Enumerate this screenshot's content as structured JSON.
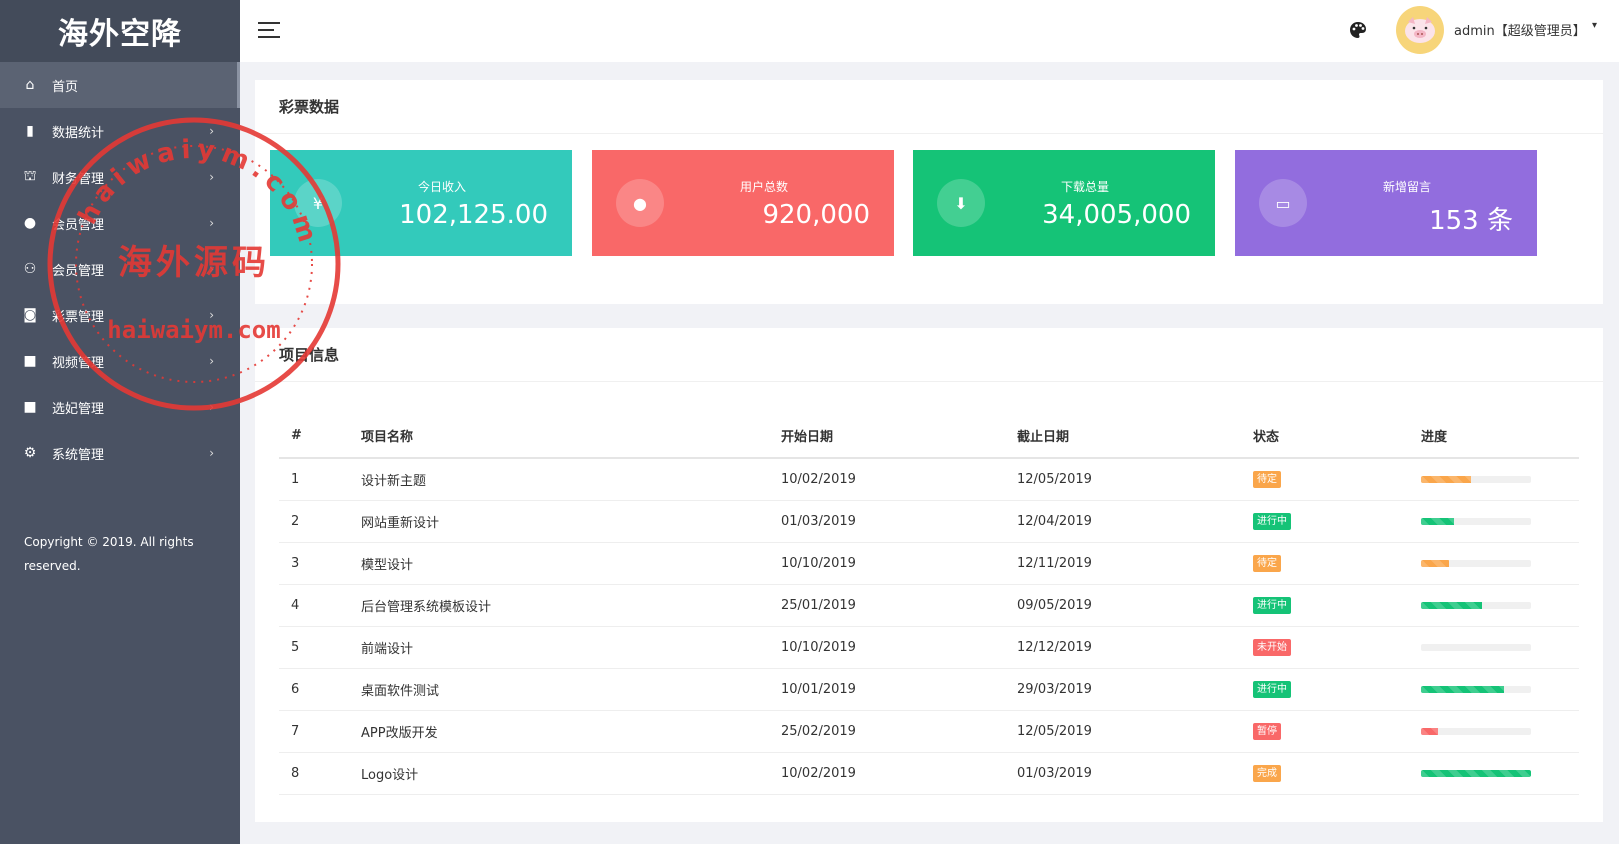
{
  "app": {
    "logo": "海外空降"
  },
  "sidebar": {
    "items": [
      {
        "label": "首页",
        "icon": "home-icon",
        "glyph": "⌂",
        "chevron": ""
      },
      {
        "label": "数据统计",
        "icon": "bar-chart-icon",
        "glyph": "▮",
        "chevron": "›"
      },
      {
        "label": "财务管理",
        "icon": "bank-icon",
        "glyph": "⛫",
        "chevron": "›"
      },
      {
        "label": "会员管理",
        "icon": "user-icon",
        "glyph": "●",
        "chevron": "›"
      },
      {
        "label": "会员管理",
        "icon": "users-icon",
        "glyph": "⚇",
        "chevron": "›"
      },
      {
        "label": "彩票管理",
        "icon": "gamepad-icon",
        "glyph": "◙",
        "chevron": "›"
      },
      {
        "label": "视频管理",
        "icon": "video-camera-icon",
        "glyph": "■",
        "chevron": "›"
      },
      {
        "label": "选妃管理",
        "icon": "video-camera-icon",
        "glyph": "■",
        "chevron": "›"
      },
      {
        "label": "系统管理",
        "icon": "gear-icon",
        "glyph": "⚙",
        "chevron": "›"
      }
    ],
    "copyright": "Copyright © 2019. All rights reserved."
  },
  "header": {
    "user": "admin【超级管理员】",
    "caret": "▾",
    "palette_icon": "palette-icon",
    "menu_icon": "hamburger-menu-icon",
    "avatar_icon": "pig-avatar-icon"
  },
  "stats_card": {
    "title": "彩票数据",
    "stats": [
      {
        "label": "今日收入",
        "value": "102,125.00",
        "icon": "yen-icon",
        "glyph": "¥",
        "color": "#33cabb"
      },
      {
        "label": "用户总数",
        "value": "920,000",
        "icon": "user-icon",
        "glyph": "●",
        "color": "#f96868"
      },
      {
        "label": "下载总量",
        "value": "34,005,000",
        "icon": "download-icon",
        "glyph": "⬇",
        "color": "#15c377"
      },
      {
        "label": "新增留言",
        "value": "153 条",
        "icon": "comment-icon",
        "glyph": "▭",
        "color": "#926dde"
      }
    ]
  },
  "project_card": {
    "title": "项目信息",
    "columns": [
      "#",
      "项目名称",
      "开始日期",
      "截止日期",
      "状态",
      "进度"
    ],
    "rows": [
      {
        "id": "1",
        "name": "设计新主题",
        "start": "10/02/2019",
        "end": "12/05/2019",
        "status": "待定",
        "status_color": "#faa64b",
        "progress": 0.45,
        "bar_color": "#faa64b"
      },
      {
        "id": "2",
        "name": "网站重新设计",
        "start": "01/03/2019",
        "end": "12/04/2019",
        "status": "进行中",
        "status_color": "#15c377",
        "progress": 0.3,
        "bar_color": "#15c377"
      },
      {
        "id": "3",
        "name": "模型设计",
        "start": "10/10/2019",
        "end": "12/11/2019",
        "status": "待定",
        "status_color": "#faa64b",
        "progress": 0.25,
        "bar_color": "#faa64b"
      },
      {
        "id": "4",
        "name": "后台管理系统模板设计",
        "start": "25/01/2019",
        "end": "09/05/2019",
        "status": "进行中",
        "status_color": "#15c377",
        "progress": 0.55,
        "bar_color": "#15c377"
      },
      {
        "id": "5",
        "name": "前端设计",
        "start": "10/10/2019",
        "end": "12/12/2019",
        "status": "未开始",
        "status_color": "#f96868",
        "progress": 0.0,
        "bar_color": "#f96868"
      },
      {
        "id": "6",
        "name": "桌面软件测试",
        "start": "10/01/2019",
        "end": "29/03/2019",
        "status": "进行中",
        "status_color": "#15c377",
        "progress": 0.75,
        "bar_color": "#15c377"
      },
      {
        "id": "7",
        "name": "APP改版开发",
        "start": "25/02/2019",
        "end": "12/05/2019",
        "status": "暂停",
        "status_color": "#f96868",
        "progress": 0.15,
        "bar_color": "#f96868"
      },
      {
        "id": "8",
        "name": "Logo设计",
        "start": "10/02/2019",
        "end": "01/03/2019",
        "status": "完成",
        "status_color": "#faa64b",
        "progress": 1.0,
        "bar_color": "#15c377"
      }
    ]
  },
  "watermark": {
    "text_top": "haiwaiym.com",
    "text_center": "海外源码",
    "text_bottom": "haiwaiym.com",
    "color": "#e53935"
  }
}
